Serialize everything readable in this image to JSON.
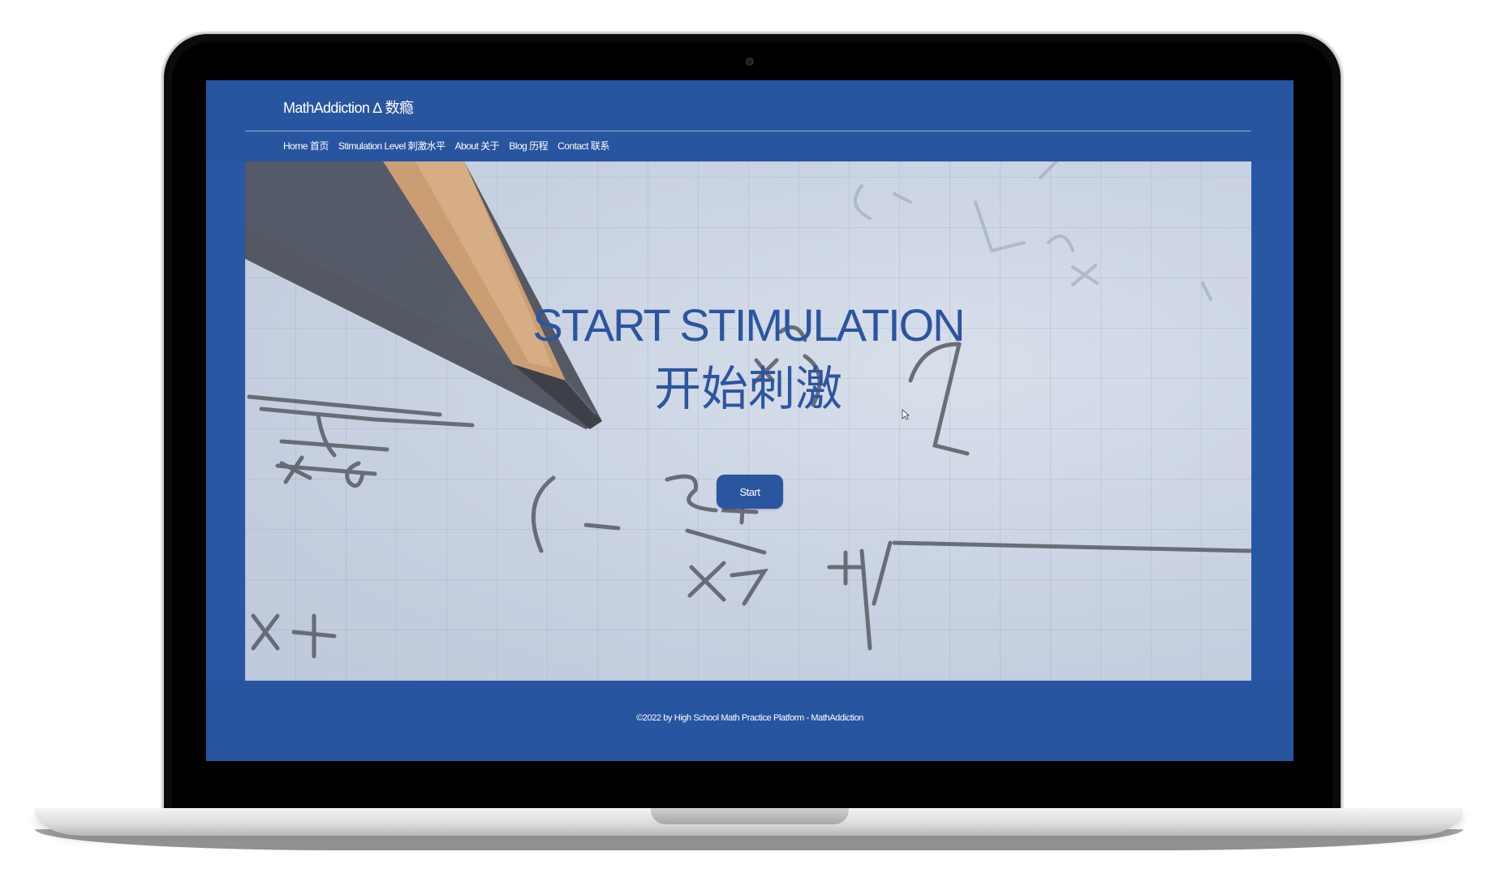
{
  "header": {
    "brand": "MathAddiction ∆ 数瘾"
  },
  "nav": {
    "items": [
      {
        "label": "Home 首页"
      },
      {
        "label": "Stimulation Level 刺激水平"
      },
      {
        "label": "About 关于"
      },
      {
        "label": "Blog 历程"
      },
      {
        "label": "Contact 联系"
      }
    ]
  },
  "hero": {
    "title": "START STIMULATION",
    "subtitle": "开始刺激",
    "start_label": "Start"
  },
  "footer": {
    "copyright": "©2022 by High School Math Practice Platform - MathAddiction"
  },
  "colors": {
    "brand_blue": "#2a57a5",
    "hero_text": "#2c55a1",
    "button": "#2a55a0"
  }
}
